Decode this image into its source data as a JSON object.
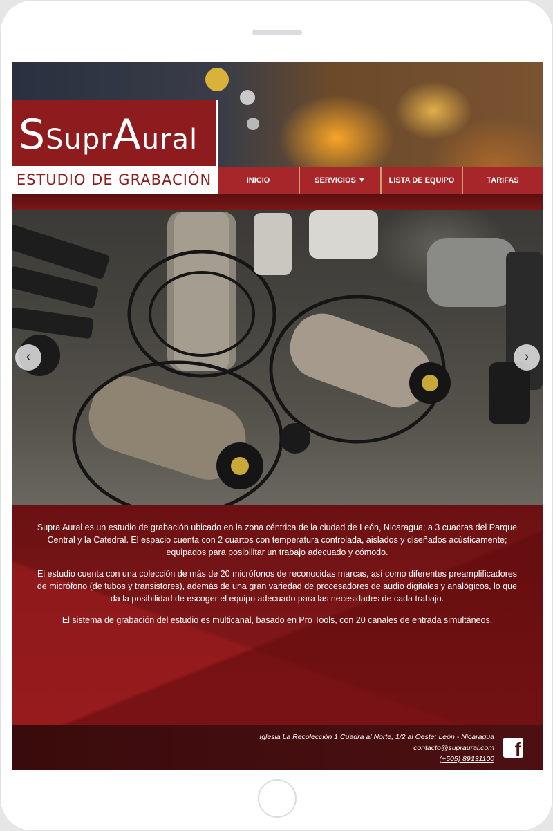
{
  "brand": {
    "name_part1": "Supr",
    "name_cap1": "A",
    "name_part2": "ural",
    "name_lead": "S",
    "tagline": "ESTUDIO DE GRABACIÓN"
  },
  "nav": {
    "items": [
      {
        "label": "INICIO"
      },
      {
        "label": "SERVICIOS ▼"
      },
      {
        "label": "LISTA DE EQUIPO"
      },
      {
        "label": "TARIFAS"
      }
    ]
  },
  "slider": {
    "prev_glyph": "‹",
    "next_glyph": "›"
  },
  "content": {
    "paragraphs": [
      "Supra Aural es un estudio de grabación ubicado en la zona céntrica de la ciudad de León, Nicaragua; a 3 cuadras del Parque Central y la Catedral. El espacio cuenta con 2 cuartos con temperatura controlada, aislados y diseñados acústicamente; equipados para posibilitar un trabajo adecuado y cómodo.",
      "El estudio cuenta con una colección de más de 20 micrófonos de reconocidas marcas, así como diferentes preamplificadores de micrófono (de tubos y transistores), además de una gran variedad de procesadores de audio digitales y analógicos, lo que da la posibilidad de escoger el equipo adecuado para las necesidades de cada trabajo.",
      "El sistema de grabación del estudio es multicanal, basado en Pro Tools, con 20 canales de entrada simultáneos."
    ]
  },
  "footer": {
    "address": "Iglesia La Recolección 1 Cuadra al Norte, 1/2 al Oeste; León - Nicaragua",
    "email": "contacto@supraural.com",
    "phone": "(+505) 89131100",
    "facebook_glyph": "f"
  },
  "colors": {
    "brand_red": "#8e1b1d",
    "nav_red": "#a6262a",
    "footer_dark": "#3a0b0c"
  }
}
